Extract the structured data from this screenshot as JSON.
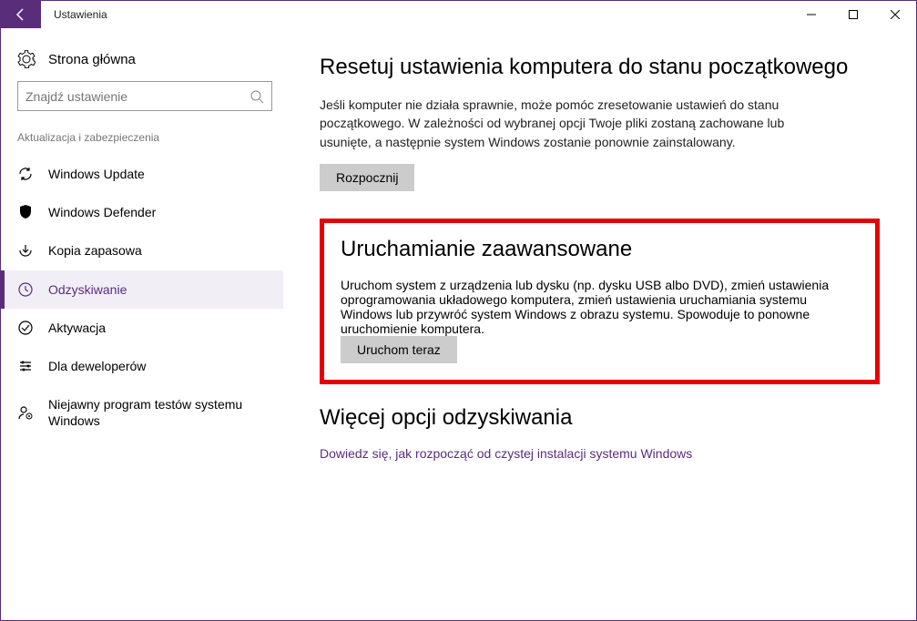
{
  "titlebar": {
    "title": "Ustawienia"
  },
  "sidebar": {
    "home_label": "Strona główna",
    "search_placeholder": "Znajdź ustawienie",
    "category_label": "Aktualizacja i zabezpieczenia",
    "items": [
      {
        "label": "Windows Update"
      },
      {
        "label": "Windows Defender"
      },
      {
        "label": "Kopia zapasowa"
      },
      {
        "label": "Odzyskiwanie"
      },
      {
        "label": "Aktywacja"
      },
      {
        "label": "Dla deweloperów"
      },
      {
        "label": "Niejawny program testów systemu Windows"
      }
    ]
  },
  "main": {
    "reset": {
      "title": "Resetuj ustawienia komputera do stanu początkowego",
      "desc": "Jeśli komputer nie działa sprawnie, może pomóc zresetowanie ustawień do stanu początkowego. W zależności od wybranej opcji Twoje pliki zostaną zachowane lub usunięte, a następnie system Windows zostanie ponownie zainstalowany.",
      "button": "Rozpocznij"
    },
    "advanced": {
      "title": "Uruchamianie zaawansowane",
      "desc": "Uruchom system z urządzenia lub dysku (np. dysku USB albo DVD), zmień ustawienia oprogramowania układowego komputera, zmień ustawienia uruchamiania systemu Windows lub przywróć system Windows z obrazu systemu. Spowoduje to ponowne uruchomienie komputera.",
      "button": "Uruchom teraz"
    },
    "more": {
      "title": "Więcej opcji odzyskiwania",
      "link": "Dowiedz się, jak rozpocząć od czystej instalacji systemu Windows"
    }
  }
}
